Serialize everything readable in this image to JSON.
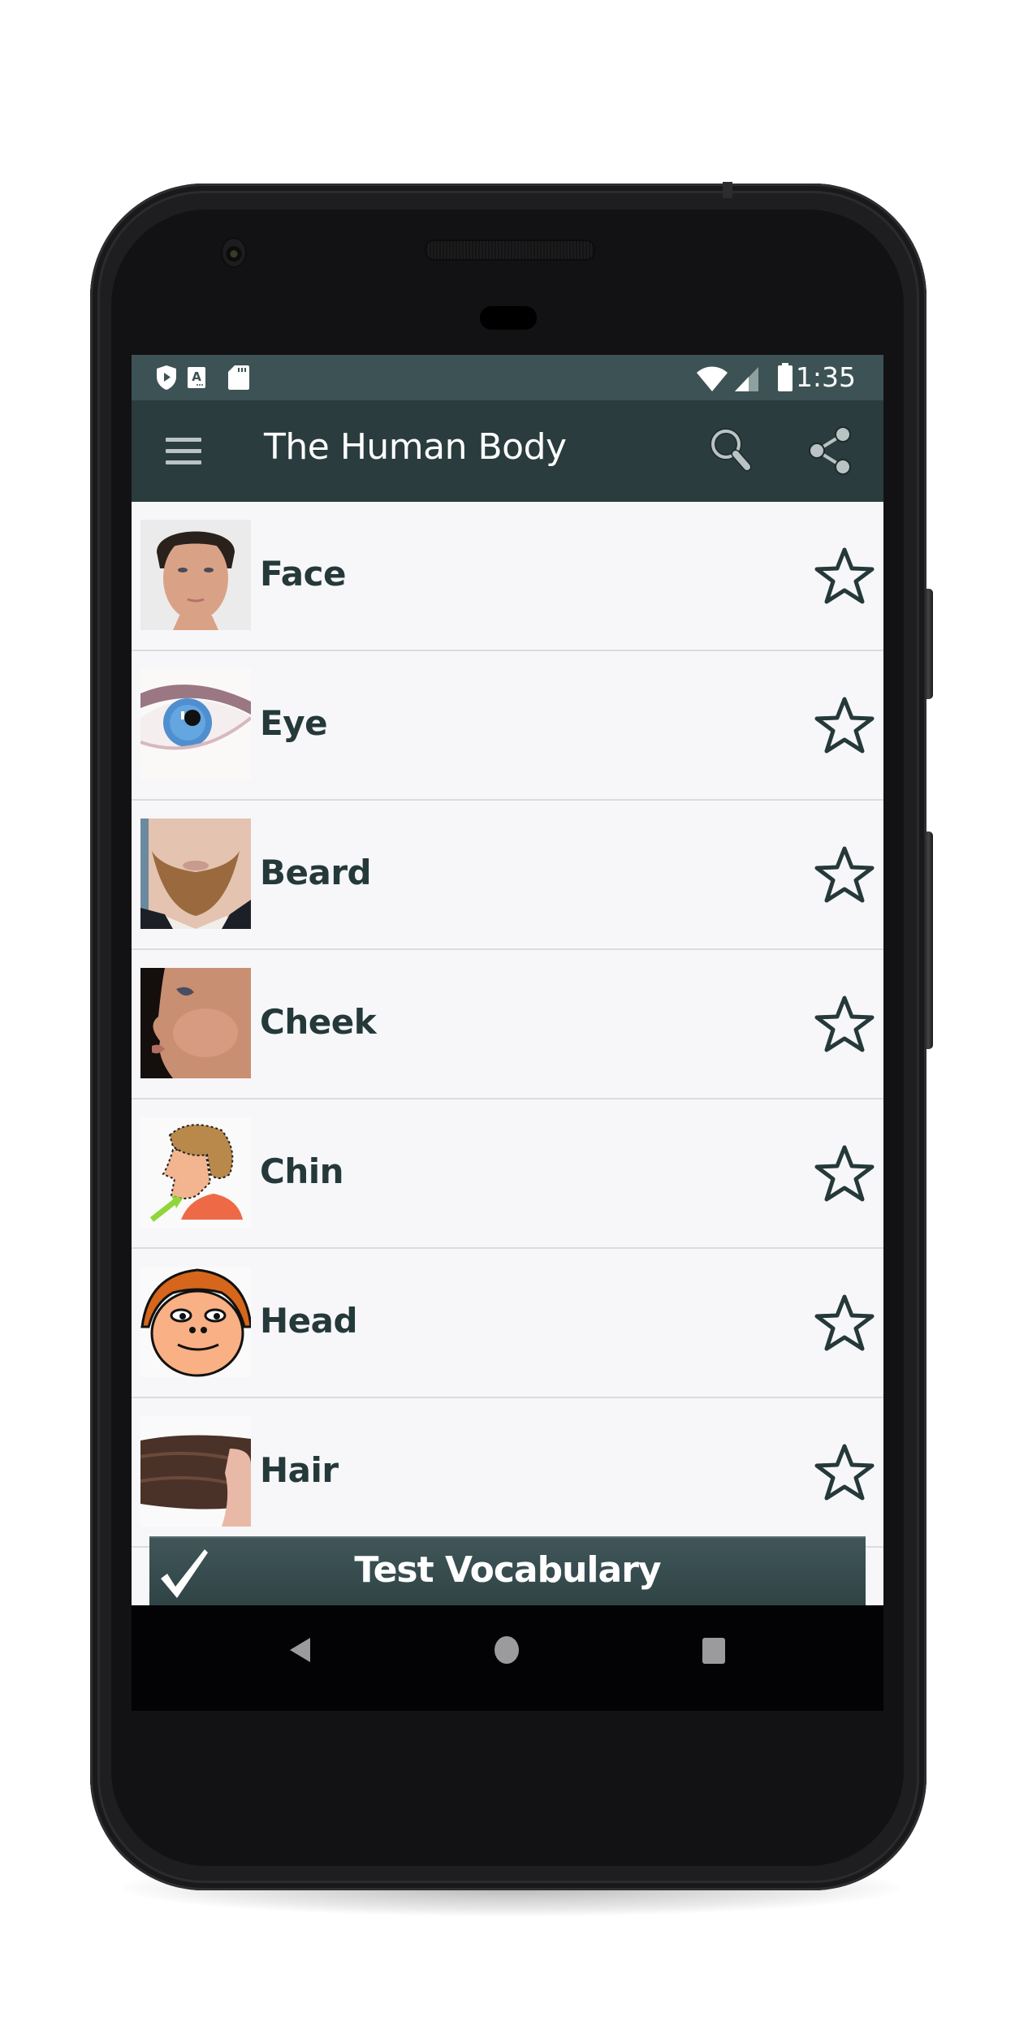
{
  "statusbar": {
    "left_icons": [
      "play-protect-shield-icon",
      "keyboard-a-icon",
      "sd-card-icon"
    ],
    "right_icons": [
      "wifi-icon",
      "signal-icon",
      "battery-icon"
    ],
    "time": "1:35"
  },
  "appbar": {
    "menu_icon": "hamburger-menu-icon",
    "title": "The Human Body",
    "actions": [
      "search-icon",
      "share-icon"
    ]
  },
  "list": {
    "items": [
      {
        "label": "Face",
        "thumbnail": "face-photo",
        "favorite": false
      },
      {
        "label": "Eye",
        "thumbnail": "eye-photo",
        "favorite": false
      },
      {
        "label": "Beard",
        "thumbnail": "beard-photo",
        "favorite": false
      },
      {
        "label": "Cheek",
        "thumbnail": "cheek-photo",
        "favorite": false
      },
      {
        "label": "Chin",
        "thumbnail": "chin-cartoon",
        "favorite": false
      },
      {
        "label": "Head",
        "thumbnail": "head-cartoon",
        "favorite": false
      },
      {
        "label": "Hair",
        "thumbnail": "hair-photo",
        "favorite": false
      }
    ]
  },
  "footer": {
    "test_button_label": "Test Vocabulary",
    "test_button_icon": "checkmark-icon"
  },
  "navbar": {
    "buttons": [
      "back",
      "home",
      "recents"
    ]
  },
  "colors": {
    "statusbar": "#3d5254",
    "appbar": "#2a3c3e",
    "list_background": "#f7f7f9",
    "label_text": "#25393a",
    "star_outline": "#25393a"
  }
}
